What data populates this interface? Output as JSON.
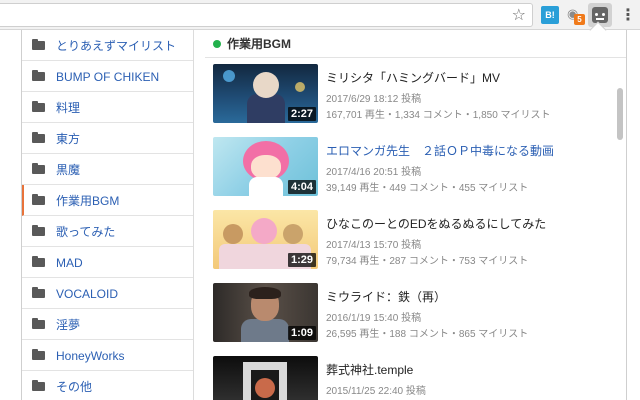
{
  "browser": {
    "star_glyph": "☆",
    "ext_b_label": "B!",
    "ext_eye_badge": "5",
    "menu_glyph": "⋮"
  },
  "sidebar": {
    "items": [
      {
        "label": "とりあえずマイリスト",
        "active": false
      },
      {
        "label": "BUMP OF CHIKEN",
        "active": false
      },
      {
        "label": "料理",
        "active": false
      },
      {
        "label": "東方",
        "active": false
      },
      {
        "label": "黒魔",
        "active": false
      },
      {
        "label": "作業用BGM",
        "active": true
      },
      {
        "label": "歌ってみた",
        "active": false
      },
      {
        "label": "MAD",
        "active": false
      },
      {
        "label": "VOCALOID",
        "active": false
      },
      {
        "label": "淫夢",
        "active": false
      },
      {
        "label": "HoneyWorks",
        "active": false
      },
      {
        "label": "その他",
        "active": false
      }
    ]
  },
  "main": {
    "list_title": "作業用BGM",
    "status_color": "#22b14c",
    "videos": [
      {
        "title": "ミリシタ「ハミングバード」MV",
        "duration": "2:27",
        "posted": "2017/6/29 18:12 投稿",
        "stats": "167,701 再生・1,334 コメント・1,850 マイリスト",
        "is_link": false
      },
      {
        "title": "エロマンガ先生　２話ＯＰ中毒になる動画",
        "duration": "4:04",
        "posted": "2017/4/16 20:51 投稿",
        "stats": "39,149 再生・449 コメント・455 マイリスト",
        "is_link": true
      },
      {
        "title": "ひなこのーとのEDをぬるぬるにしてみた",
        "duration": "1:29",
        "posted": "2017/4/13 15:70 投稿",
        "stats": "79,734 再生・287 コメント・753 マイリスト",
        "is_link": false
      },
      {
        "title": "ミウライド：鉄（再）",
        "duration": "1:09",
        "posted": "2016/1/19 15:40 投稿",
        "stats": "26,595 再生・188 コメント・865 マイリスト",
        "is_link": false
      },
      {
        "title": "葬式神社.temple",
        "duration": "",
        "posted": "2015/11/25 22:40 投稿",
        "stats": "",
        "is_link": false
      }
    ]
  }
}
